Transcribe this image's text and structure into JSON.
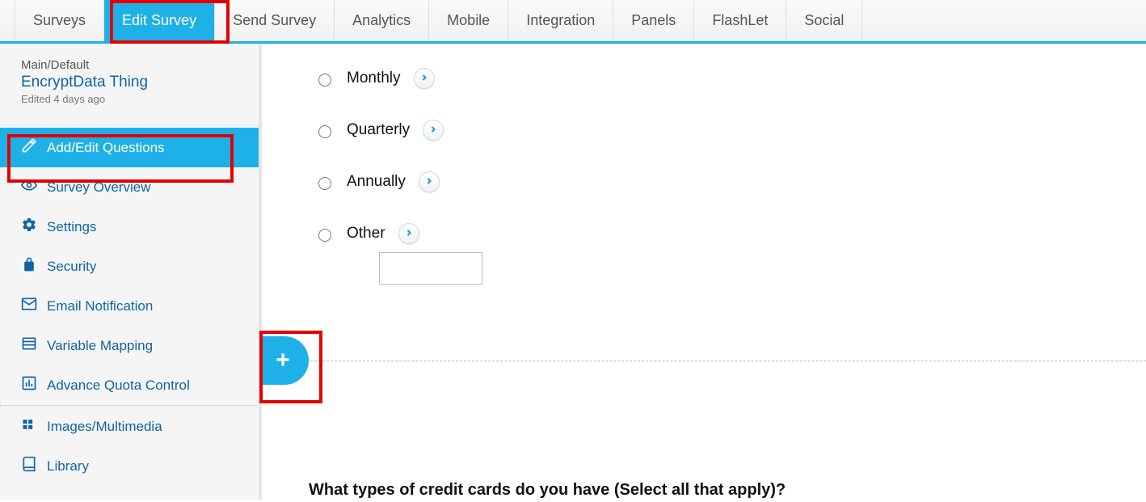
{
  "topTabs": {
    "t0": "Surveys",
    "t1": "Edit Survey",
    "t2": "Send Survey",
    "t3": "Analytics",
    "t4": "Mobile",
    "t5": "Integration",
    "t6": "Panels",
    "t7": "FlashLet",
    "t8": "Social"
  },
  "surveyMeta": {
    "path": "Main/Default",
    "title": "EncryptData Thing",
    "edited": "Edited 4 days ago"
  },
  "sideNav": {
    "addEdit": "Add/Edit Questions",
    "overview": "Survey Overview",
    "settings": "Settings",
    "security": "Security",
    "email": "Email Notification",
    "varmap": "Variable Mapping",
    "quota": "Advance Quota Control",
    "images": "Images/Multimedia",
    "library": "Library"
  },
  "options": {
    "o1": "Monthly",
    "o2": "Quarterly",
    "o3": "Annually",
    "o4": "Other"
  },
  "nextQuestion": "What types of credit cards do you have (Select all that apply)?"
}
